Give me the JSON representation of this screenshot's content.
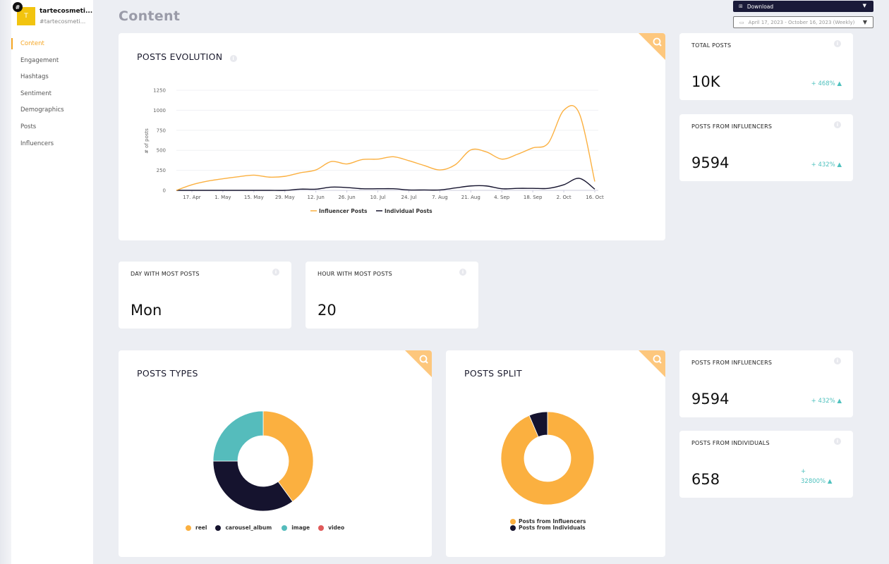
{
  "brand": {
    "logo_letter": "T",
    "badge": "#",
    "name": "tartecosmeti...",
    "handle": "#tartecosmeti..."
  },
  "sidebar": {
    "items": [
      {
        "label": "Content",
        "active": true
      },
      {
        "label": "Engagement",
        "active": false
      },
      {
        "label": "Hashtags",
        "active": false
      },
      {
        "label": "Sentiment",
        "active": false
      },
      {
        "label": "Demographics",
        "active": false
      },
      {
        "label": "Posts",
        "active": false
      },
      {
        "label": "Influencers",
        "active": false
      }
    ]
  },
  "header": {
    "title": "Content",
    "download_label": "Download",
    "date_range": "April 17, 2023 - October 16, 2023 (Weekly)"
  },
  "colors": {
    "accent": "#f5a623",
    "orange": "#fbb040",
    "navy": "#15132e",
    "teal": "#55bcbc",
    "red": "#e05a5a",
    "positive": "#4fc1be"
  },
  "posts_evolution": {
    "title": "POSTS EVOLUTION",
    "info": "i"
  },
  "stats": {
    "total_posts": {
      "title": "TOTAL POSTS",
      "value": "10K",
      "change": "+ 468% ▲"
    },
    "posts_from_influencers_top": {
      "title": "POSTS FROM INFLUENCERS",
      "value": "9594",
      "change": "+ 432% ▲"
    },
    "day_most_posts": {
      "title": "DAY WITH MOST POSTS",
      "value": "Mon"
    },
    "hour_most_posts": {
      "title": "HOUR WITH MOST POSTS",
      "value": "20"
    },
    "posts_from_influencers": {
      "title": "POSTS FROM INFLUENCERS",
      "value": "9594",
      "change": "+ 432% ▲"
    },
    "posts_from_individuals": {
      "title": "POSTS FROM INDIVIDUALS",
      "value": "658",
      "change_sign": "+",
      "change": "32800% ▲"
    }
  },
  "posts_types": {
    "title": "POSTS TYPES"
  },
  "posts_split": {
    "title": "POSTS SPLIT"
  },
  "chart_data": [
    {
      "type": "line",
      "title": "POSTS EVOLUTION",
      "xlabel": "",
      "ylabel": "# of posts",
      "ylim": [
        0,
        1250
      ],
      "yticks": [
        0,
        250,
        500,
        750,
        1000,
        1250
      ],
      "grid": true,
      "legend": "bottom",
      "xtick_labels": [
        "17. Apr",
        "1. May",
        "15. May",
        "29. May",
        "12. Jun",
        "26. Jun",
        "10. Jul",
        "24. Jul",
        "7. Aug",
        "21. Aug",
        "4. Sep",
        "18. Sep",
        "2. Oct",
        "16. Oct"
      ],
      "x": [
        "10. Apr",
        "17. Apr",
        "24. Apr",
        "1. May",
        "8. May",
        "15. May",
        "22. May",
        "29. May",
        "5. Jun",
        "12. Jun",
        "19. Jun",
        "26. Jun",
        "3. Jul",
        "10. Jul",
        "17. Jul",
        "24. Jul",
        "31. Jul",
        "7. Aug",
        "14. Aug",
        "21. Aug",
        "28. Aug",
        "4. Sep",
        "11. Sep",
        "18. Sep",
        "25. Sep",
        "2. Oct",
        "9. Oct",
        "16. Oct"
      ],
      "series": [
        {
          "name": "Influencer Posts",
          "color": "#fbb040",
          "values": [
            0,
            70,
            115,
            145,
            170,
            190,
            165,
            175,
            220,
            255,
            360,
            330,
            385,
            390,
            420,
            370,
            310,
            255,
            320,
            505,
            480,
            390,
            450,
            530,
            590,
            1000,
            960,
            110
          ]
        },
        {
          "name": "Individual Posts",
          "color": "#15132e",
          "values": [
            0,
            0,
            0,
            0,
            0,
            0,
            0,
            0,
            15,
            15,
            40,
            35,
            20,
            20,
            20,
            5,
            5,
            5,
            30,
            55,
            55,
            20,
            25,
            25,
            25,
            70,
            150,
            15
          ]
        }
      ]
    },
    {
      "type": "pie",
      "title": "POSTS TYPES",
      "legend": "bottom",
      "labels": [
        "reel",
        "carousel_album",
        "image",
        "video"
      ],
      "values": [
        40,
        35,
        25,
        0
      ],
      "colors": [
        "#fbb040",
        "#15132e",
        "#55bcbc",
        "#e05a5a"
      ]
    },
    {
      "type": "pie",
      "title": "POSTS SPLIT",
      "legend": "bottom",
      "labels": [
        "Posts from Influencers",
        "Posts from Individuals"
      ],
      "values": [
        9594,
        658
      ],
      "colors": [
        "#fbb040",
        "#15132e"
      ]
    }
  ]
}
